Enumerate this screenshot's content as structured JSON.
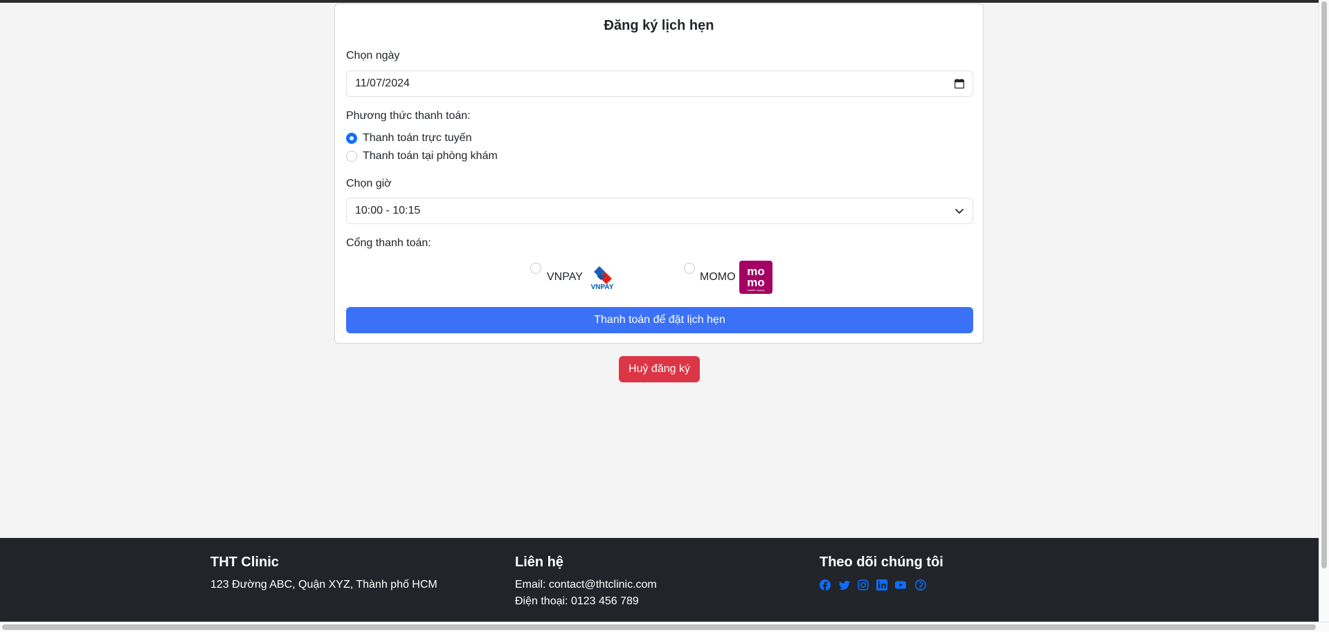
{
  "form": {
    "title": "Đăng ký lịch hẹn",
    "date_label": "Chọn ngày",
    "date_value": "11/07/2024",
    "payment_method_label": "Phương thức thanh toán:",
    "payment_methods": [
      {
        "label": "Thanh toán trực tuyến",
        "checked": true
      },
      {
        "label": "Thanh toán tại phòng khám",
        "checked": false
      }
    ],
    "time_label": "Chọn giờ",
    "time_value": "10:00 - 10:15",
    "gateway_label": "Cổng thanh toán:",
    "gateways": [
      {
        "label": "VNPAY",
        "checked": false,
        "logo": "vnpay-logo"
      },
      {
        "label": "MOMO",
        "checked": false,
        "logo": "momo-logo"
      }
    ],
    "momo_logo_text": [
      "mo",
      "mo"
    ],
    "momo_logo_subtext": "mobile money",
    "vnpay_logo_text": "VNPAY",
    "submit_label": "Thanh toán để đặt lịch hẹn",
    "cancel_label": "Huỷ đăng ký"
  },
  "footer": {
    "clinic_name": "THT Clinic",
    "address": "123 Đường ABC, Quận XYZ, Thành phố HCM",
    "contact_heading": "Liên hệ",
    "email": "Email: contact@thtclinic.com",
    "phone": "Điện thoại: 0123 456 789",
    "follow_heading": "Theo dõi chúng tôi",
    "social_icons": [
      "facebook-icon",
      "twitter-icon",
      "instagram-icon",
      "linkedin-icon",
      "youtube-icon",
      "pinterest-icon"
    ]
  },
  "colors": {
    "primary": "#3b71f6",
    "danger": "#dc3545",
    "footer_bg": "#212529",
    "social": "#0d6efd",
    "momo": "#a50064"
  }
}
